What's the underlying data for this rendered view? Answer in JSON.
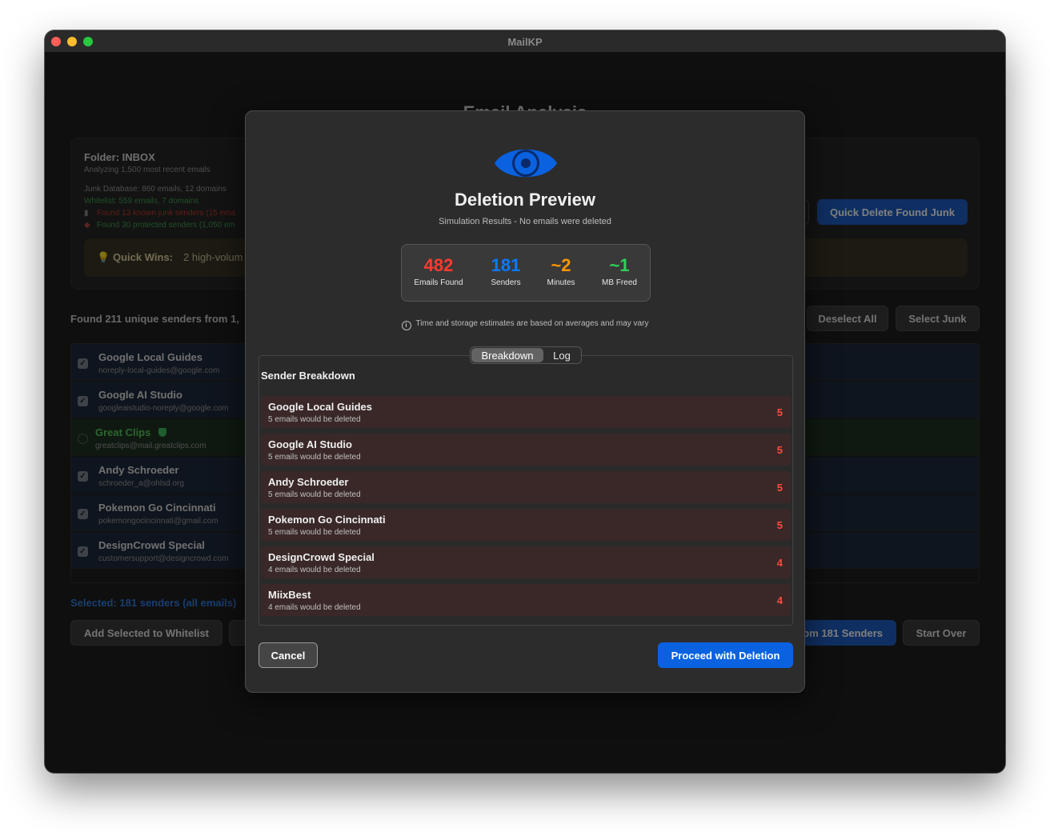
{
  "window": {
    "title": "MailKP"
  },
  "background": {
    "page_title": "Email Analysis",
    "folder_title": "Folder: INBOX",
    "folder_sub": "Analyzing 1,500 most recent emails",
    "junk_db": "Junk Database: 860 emails, 12 domains",
    "whitelist": "Whitelist: 559 emails, 7 domains",
    "found_junk": "Found 13 known junk senders (15 ema",
    "found_protected": "Found 30 protected senders (1,050 em",
    "quick_wins_label": "Quick Wins:",
    "quick_wins_text": "2 high-volum",
    "quick_delete_label": "Quick Delete Found Junk",
    "found_line": "Found 211 unique senders from 1,",
    "deselect_all": "Deselect All",
    "select_junk": "Select Junk",
    "rows": [
      {
        "name": "Google Local Guides",
        "email": "noreply-local-guides@google.com"
      },
      {
        "name": "Google AI Studio",
        "email": "googleaistudio-noreply@google.com"
      },
      {
        "name": "Great Clips",
        "email": "greatclips@mail.greatclips.com"
      },
      {
        "name": "Andy Schroeder",
        "email": "schroeder_a@ohlsd.org"
      },
      {
        "name": "Pokemon Go Cincinnati",
        "email": "pokemongocincinnati@gmail.com"
      },
      {
        "name": "DesignCrowd Special",
        "email": "customersupport@designcrowd.com"
      }
    ],
    "selected_line": "Selected: 181 senders (all emails)",
    "add_whitelist": "Add Selected to Whitelist",
    "delete_from": "om 181 Senders",
    "start_over": "Start Over"
  },
  "modal": {
    "title": "Deletion Preview",
    "subtitle": "Simulation Results - No emails were deleted",
    "stats": [
      {
        "value": "482",
        "label": "Emails Found",
        "color": "#ff3b30"
      },
      {
        "value": "181",
        "label": "Senders",
        "color": "#0a7aff"
      },
      {
        "value": "~2",
        "label": "Minutes",
        "color": "#ff9500"
      },
      {
        "value": "~1",
        "label": "MB Freed",
        "color": "#30d158"
      }
    ],
    "note": "Time and storage estimates are based on averages and may vary",
    "tabs": [
      "Breakdown",
      "Log"
    ],
    "panel_title": "Sender Breakdown",
    "breakdown": [
      {
        "name": "Google Local Guides",
        "sub": "5 emails would be deleted",
        "count": "5"
      },
      {
        "name": "Google AI Studio",
        "sub": "5 emails would be deleted",
        "count": "5"
      },
      {
        "name": "Andy Schroeder",
        "sub": "5 emails would be deleted",
        "count": "5"
      },
      {
        "name": "Pokemon Go Cincinnati",
        "sub": "5 emails would be deleted",
        "count": "5"
      },
      {
        "name": "DesignCrowd Special",
        "sub": "4 emails would be deleted",
        "count": "4"
      },
      {
        "name": "MiixBest",
        "sub": "4 emails would be deleted",
        "count": "4"
      }
    ],
    "cancel_label": "Cancel",
    "proceed_label": "Proceed with Deletion"
  }
}
